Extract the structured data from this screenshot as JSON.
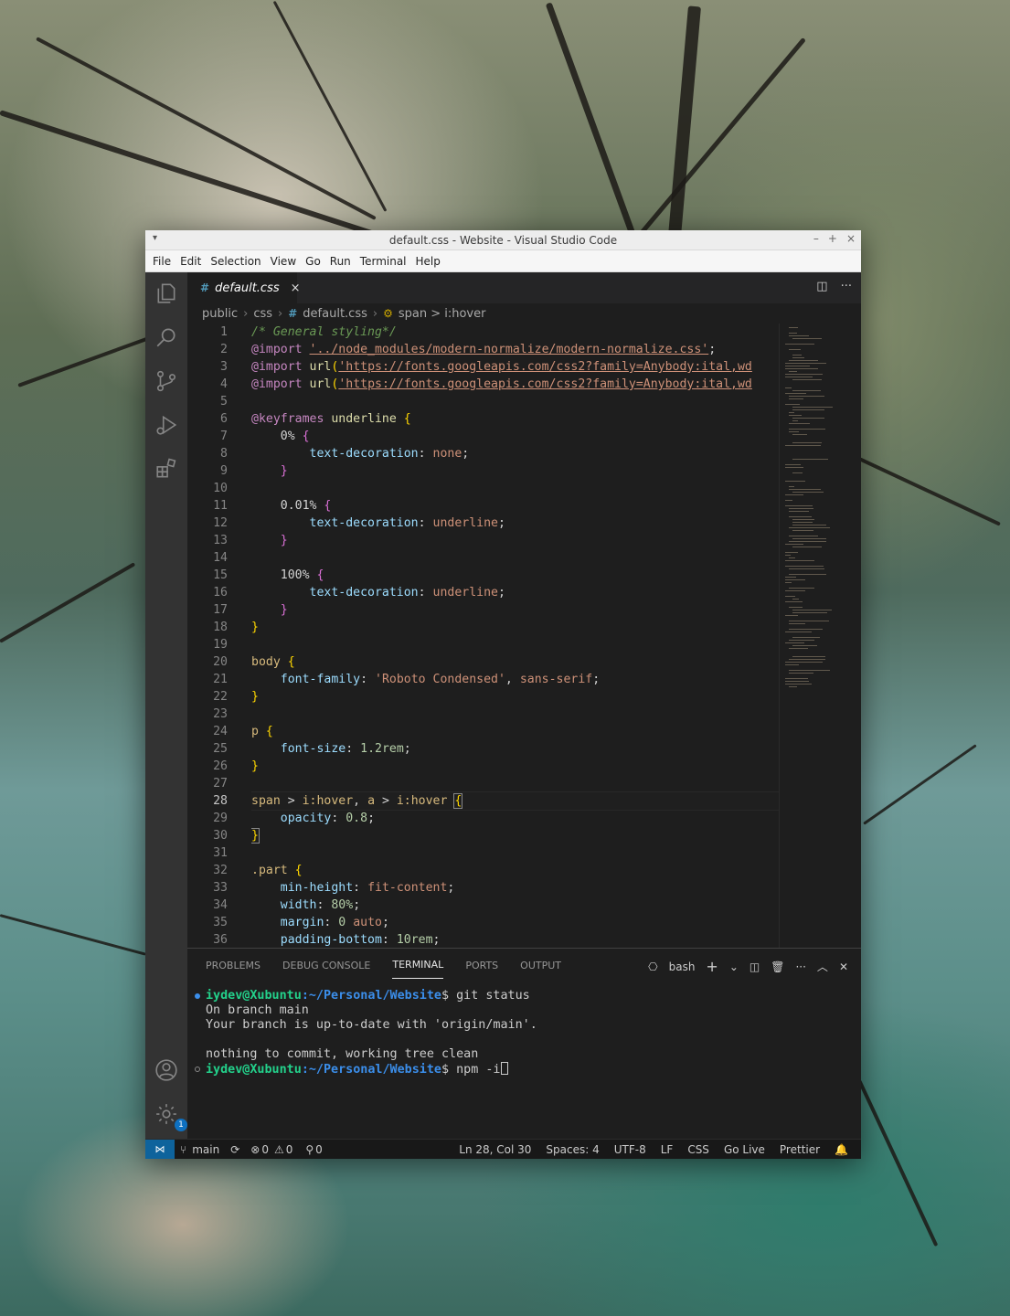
{
  "window": {
    "title": "default.css - Website - Visual Studio Code",
    "controls": [
      "–",
      "+",
      "×"
    ]
  },
  "menu": [
    "File",
    "Edit",
    "Selection",
    "View",
    "Go",
    "Run",
    "Terminal",
    "Help"
  ],
  "activity_icons": [
    "explorer-icon",
    "search-icon",
    "source-control-icon",
    "run-debug-icon",
    "extensions-icon",
    "account-icon",
    "manage-gear-icon"
  ],
  "manage_badge": "1",
  "tab": {
    "hash": "#",
    "label": "default.css",
    "close": "×"
  },
  "breadcrumb": {
    "part1": "public",
    "part2": "css",
    "file": "default.css",
    "symbol": "span > i:hover"
  },
  "editor": {
    "active_line": 28,
    "lines": [
      {
        "n": "1"
      },
      {
        "n": "2"
      },
      {
        "n": "3"
      },
      {
        "n": "4"
      },
      {
        "n": "5"
      },
      {
        "n": "6"
      },
      {
        "n": "7"
      },
      {
        "n": "8"
      },
      {
        "n": "9"
      },
      {
        "n": "10"
      },
      {
        "n": "11"
      },
      {
        "n": "12"
      },
      {
        "n": "13"
      },
      {
        "n": "14"
      },
      {
        "n": "15"
      },
      {
        "n": "16"
      },
      {
        "n": "17"
      },
      {
        "n": "18"
      },
      {
        "n": "19"
      },
      {
        "n": "20"
      },
      {
        "n": "21"
      },
      {
        "n": "22"
      },
      {
        "n": "23"
      },
      {
        "n": "24"
      },
      {
        "n": "25"
      },
      {
        "n": "26"
      },
      {
        "n": "27"
      },
      {
        "n": "28"
      },
      {
        "n": "29"
      },
      {
        "n": "30"
      },
      {
        "n": "31"
      },
      {
        "n": "32"
      },
      {
        "n": "33"
      },
      {
        "n": "34"
      },
      {
        "n": "35"
      },
      {
        "n": "36"
      }
    ],
    "code": {
      "l1": "/* General styling*/",
      "l2a": "@import",
      "l2b": "'../node_modules/modern-normalize/modern-normalize.css'",
      "l2c": ";",
      "l3a": "@import",
      "l3b": "url",
      "l3c": "'https://fonts.googleapis.com/css2?family=Anybody:ital,wd",
      "l4a": "@import",
      "l4b": "url",
      "l4c": "'https://fonts.googleapis.com/css2?family=Anybody:ital,wd",
      "l6a": "@keyframes",
      "l6b": "underline",
      "l7": "0%",
      "l8p": "text-decoration",
      "l8v": "none",
      "l11": "0.01%",
      "l12p": "text-decoration",
      "l12v": "underline",
      "l15": "100%",
      "l16p": "text-decoration",
      "l16v": "underline",
      "l20": "body",
      "l21p": "font-family",
      "l21v1": "'Roboto Condensed'",
      "l21v2": "sans-serif",
      "l24": "p",
      "l25p": "font-size",
      "l25v": "1.2rem",
      "l28a": "span",
      "l28b": "i:hover",
      "l28c": "a",
      "l28d": "i:hover",
      "l29p": "opacity",
      "l29v": "0.8",
      "l32": ".part",
      "l33p": "min-height",
      "l33v": "fit-content",
      "l34p": "width",
      "l34v": "80%",
      "l35p": "margin",
      "l35v1": "0",
      "l35v2": "auto",
      "l36p": "padding-bottom",
      "l36v": "10rem"
    }
  },
  "panel": {
    "tabs": [
      "PROBLEMS",
      "DEBUG CONSOLE",
      "TERMINAL",
      "PORTS",
      "OUTPUT"
    ],
    "active_tab": "TERMINAL",
    "shell": "bash"
  },
  "terminal": {
    "user": "iydev@Xubuntu",
    "path": ":~/Personal/Website",
    "cmd1": "$ git status",
    "out1": "On branch main",
    "out2": "Your branch is up-to-date with 'origin/main'.",
    "out3": "nothing to commit, working tree clean",
    "cmd2": "$ npm -i"
  },
  "status": {
    "branch": "main",
    "errors": "0",
    "warnings": "0",
    "ports": "0",
    "position": "Ln 28, Col 30",
    "spaces": "Spaces: 4",
    "encoding": "UTF-8",
    "eol": "LF",
    "language": "CSS",
    "golive": "Go Live",
    "prettier": "Prettier"
  },
  "colors": {
    "editor_bg": "#1e1e1e",
    "activity_bg": "#333333",
    "remote_bg": "#0e639c",
    "string": "#ce9178",
    "property": "#9cdcfe",
    "comment": "#6a9955"
  }
}
